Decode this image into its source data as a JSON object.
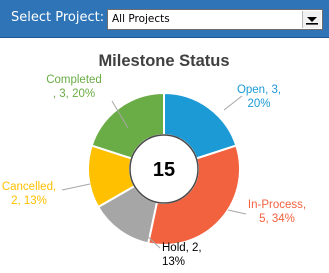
{
  "header": {
    "select_label": "Select Project:",
    "dropdown_value": "All Projects"
  },
  "chart_data": {
    "type": "pie",
    "title": "Milestone Status",
    "center_value": "15",
    "slices": [
      {
        "name": "Open",
        "value": 3,
        "percent": "20%",
        "color": "#1b9ad6",
        "label_lines": [
          "Open, 3,",
          "20%"
        ]
      },
      {
        "name": "In-Process",
        "value": 5,
        "percent": "34%",
        "color": "#f3623f",
        "label_lines": [
          "In-Process,",
          "5, 34%"
        ]
      },
      {
        "name": "Hold",
        "value": 2,
        "percent": "13%",
        "color": "#a6a6a6",
        "label_lines": [
          "Hold, 2,",
          "13%"
        ]
      },
      {
        "name": "Cancelled",
        "value": 2,
        "percent": "13%",
        "color": "#ffc000",
        "label_lines": [
          "Cancelled,",
          "2, 13%"
        ]
      },
      {
        "name": "Completed",
        "value": 3,
        "percent": "20%",
        "color": "#6aac45",
        "label_lines": [
          "Completed",
          ", 3, 20%"
        ]
      }
    ]
  }
}
